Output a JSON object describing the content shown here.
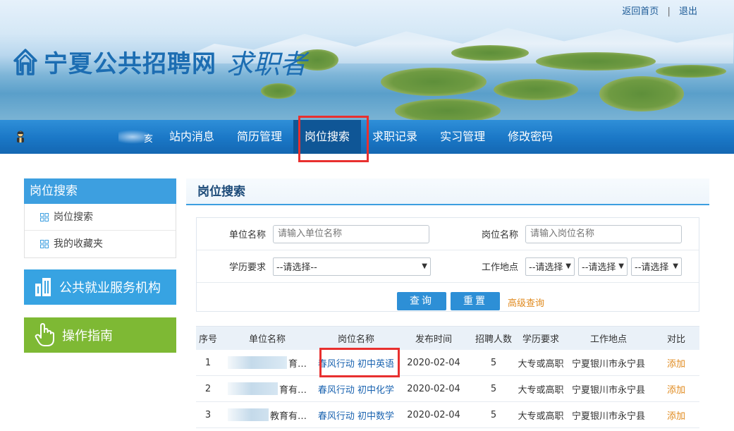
{
  "header": {
    "site_name": "宁夏公共招聘网",
    "site_sub": "求职者",
    "home_link": "返回首页",
    "separator": "|",
    "logout_link": "退出"
  },
  "nav": {
    "user_name_partial": "亥",
    "items": [
      {
        "label": "站内消息"
      },
      {
        "label": "简历管理"
      },
      {
        "label": "岗位搜索",
        "active": true
      },
      {
        "label": "求职记录"
      },
      {
        "label": "实习管理"
      },
      {
        "label": "修改密码"
      }
    ]
  },
  "sidebar": {
    "title": "岗位搜索",
    "items": [
      {
        "label": "岗位搜索"
      },
      {
        "label": "我的收藏夹"
      }
    ],
    "card_service": "公共就业服务机构",
    "card_guide": "操作指南"
  },
  "main": {
    "title": "岗位搜索",
    "search": {
      "unit_label": "单位名称",
      "unit_placeholder": "请输入单位名称",
      "position_label": "岗位名称",
      "position_placeholder": "请输入岗位名称",
      "edu_label": "学历要求",
      "edu_selected": "--请选择--",
      "location_label": "工作地点",
      "location_selected_1": "--请选择",
      "location_selected_2": "--请选择",
      "location_selected_3": "--请选择",
      "query_button": "查询",
      "reset_button": "重置",
      "advanced_link": "高级查询"
    },
    "table": {
      "headers": [
        "序号",
        "单位名称",
        "岗位名称",
        "发布时间",
        "招聘人数",
        "学历要求",
        "工作地点",
        "对比"
      ],
      "rows": [
        {
          "idx": "1",
          "unit_tail": "育…",
          "position": "春风行动  初中英语",
          "date": "2020-02-04",
          "count": "5",
          "edu": "大专或高职",
          "location": "宁夏银川市永宁县",
          "action": "添加"
        },
        {
          "idx": "2",
          "unit_tail": "育有…",
          "position": "春风行动  初中化学",
          "date": "2020-02-04",
          "count": "5",
          "edu": "大专或高职",
          "location": "宁夏银川市永宁县",
          "action": "添加"
        },
        {
          "idx": "3",
          "unit_tail": "教育有…",
          "position": "春风行动  初中数学",
          "date": "2020-02-04",
          "count": "5",
          "edu": "大专或高职",
          "location": "宁夏银川市永宁县",
          "action": "添加"
        }
      ]
    }
  },
  "colors": {
    "nav_blue": "#1a77c6",
    "nav_active": "#0f5696",
    "accent_blue": "#3d9fe0",
    "guide_green": "#7eb934",
    "link_orange": "#e08a1e",
    "highlight_red": "#e8302f"
  }
}
